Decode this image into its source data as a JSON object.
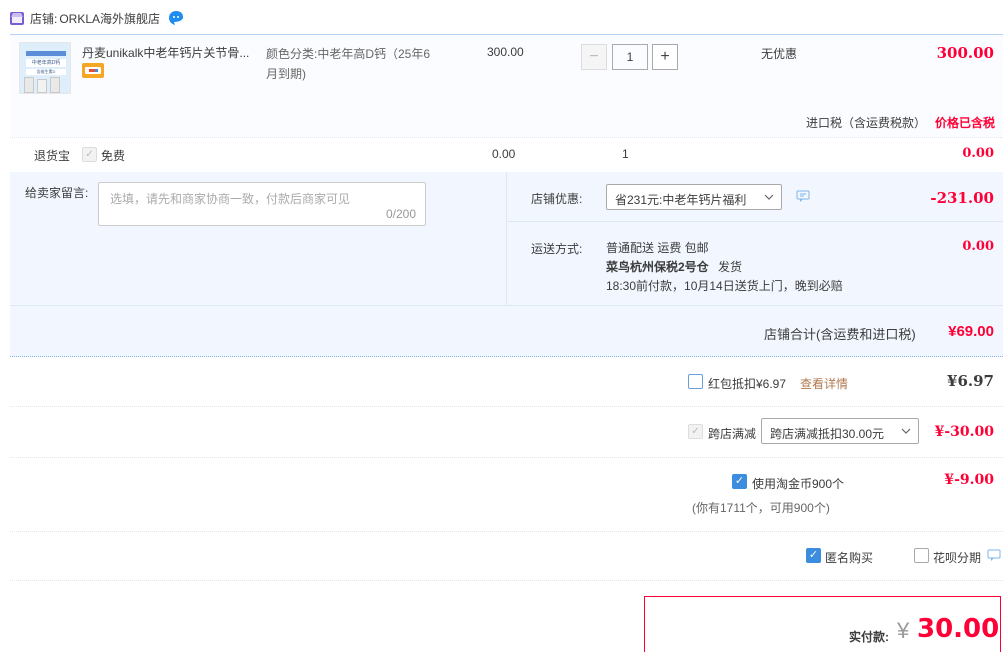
{
  "shop": {
    "label": "店铺:",
    "name": "ORKLA海外旗舰店"
  },
  "item": {
    "title": "丹麦unikalk中老年钙片关节骨...",
    "sku_label": "颜色分类:",
    "sku_value_line1": "中老年高D钙（25年6",
    "sku_value_line2": "月到期)",
    "unit_price": "300.00",
    "quantity": "1",
    "discount": "无优惠",
    "subtotal": "300.00",
    "decrease_btn": "−",
    "increase_btn": "+",
    "thumb_text_1": "中老年高D钙",
    "thumb_text_2": "含维生素D"
  },
  "tax": {
    "label": "进口税（含运费税款）",
    "value": "价格已含税"
  },
  "return_insurance": {
    "label": "退货宝",
    "option": "免费",
    "price": "0.00",
    "qty": "1",
    "total": "0.00"
  },
  "message": {
    "label": "给卖家留言:",
    "placeholder": "选填，请先和商家协商一致，付款后商家可见",
    "counter": "0/200"
  },
  "shop_discount": {
    "label": "店铺优惠:",
    "selected": "省231元:中老年钙片福利",
    "amount": "-231.00"
  },
  "shipping": {
    "label": "运送方式:",
    "line1": "普通配送 运费 包邮",
    "line2_bold": "菜鸟杭州保税2号仓",
    "line2_rest": "发货",
    "line3": "18:30前付款，10月14日送货上门，晚到必赔",
    "amount": "0.00"
  },
  "shop_total": {
    "label": "店铺合计(含运费和进口税)",
    "amount": "¥69.00"
  },
  "red_packet": {
    "label": "红包抵扣¥6.97",
    "link": "查看详情",
    "amount": "¥6.97"
  },
  "cross_shop": {
    "label": "跨店满减",
    "selected": "跨店满减抵扣30.00元",
    "amount": "¥-30.00"
  },
  "taojinbi": {
    "label": "使用淘金币900个",
    "note": "(你有1711个，可用900个)",
    "amount": "¥-9.00"
  },
  "options": {
    "anonymous": "匿名购买",
    "huabei": "花呗分期"
  },
  "pay": {
    "label": "实付款:",
    "currency": "¥",
    "amount": "30.00"
  },
  "colors": {
    "accent_red": "#ff0036",
    "link_orange": "#f40",
    "checkbox_blue": "#3c8dde",
    "panel_blue": "#f2f7ff"
  }
}
